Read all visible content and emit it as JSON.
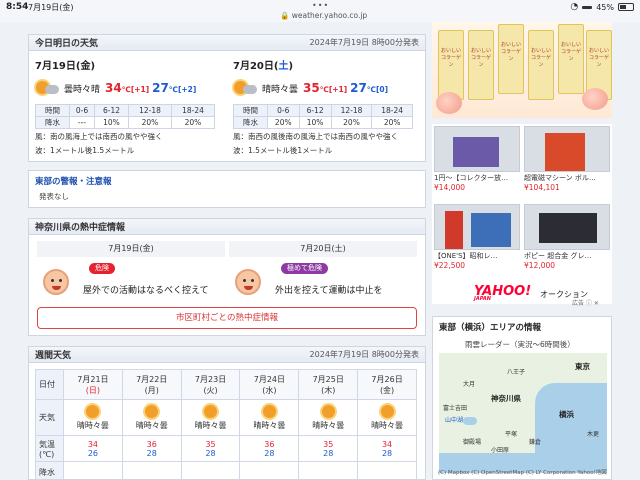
{
  "status_bar": {
    "time": "8:54",
    "date": "7月19日(金)",
    "dots": "•••",
    "url": "weather.yahoo.co.jp",
    "battery": "45%"
  },
  "forecast": {
    "title": "今日明日の天気",
    "published": "2024年7月19日 8時00分発表",
    "today": {
      "date_main": "7月19日(金)",
      "weather": "曇時々晴",
      "high": "34",
      "high_diff": "[+1]",
      "low": "27",
      "low_diff": "[+2]",
      "unit": "℃"
    },
    "tomorrow": {
      "date_prefix": "7月20日(",
      "date_day": "土",
      "date_suffix": ")",
      "weather": "晴時々曇",
      "high": "35",
      "high_diff": "[+1]",
      "low": "27",
      "low_diff": "[0]",
      "unit": "℃"
    },
    "table_labels": {
      "time": "時間",
      "rain": "降水"
    },
    "periods": [
      "0-6",
      "6-12",
      "12-18",
      "18-24"
    ],
    "today_rain": [
      "---",
      "10%",
      "20%",
      "20%"
    ],
    "tomorrow_rain": [
      "20%",
      "10%",
      "20%",
      "20%"
    ],
    "today_wind": "風：南の風海上では南西の風やや強く",
    "today_wave": "波：1メートル後1.5メートル",
    "tomorrow_wind": "風：南西の風後南の風海上では南西の風やや強く",
    "tomorrow_wave": "波：1.5メートル後1メートル"
  },
  "warnings": {
    "title": "東部の警報・注意報",
    "body": "発表なし"
  },
  "heatstroke": {
    "title": "神奈川県の熱中症情報",
    "tabs": [
      "7月19日(金)",
      "7月20日(土)"
    ],
    "items": [
      {
        "badge": "危険",
        "text": "屋外での活動はなるべく控えて",
        "color": "#e4232f"
      },
      {
        "badge": "極めて危険",
        "text": "外出を控えて運動は中止を",
        "color": "#8e3aa3"
      }
    ],
    "button": "市区町村ごとの熱中症情報"
  },
  "weekly": {
    "title": "週間天気",
    "published": "2024年7月19日 8時00分発表",
    "labels": {
      "date": "日付",
      "weather": "天気",
      "temp": "気温\n(℃)",
      "rain": "降水"
    },
    "days": [
      {
        "date": "7月21日",
        "dow": "(日)",
        "dow_color": "#e4232f",
        "weather": "晴時々曇",
        "high": "34",
        "low": "26"
      },
      {
        "date": "7月22日",
        "dow": "(月)",
        "dow_color": "#333333",
        "weather": "晴時々曇",
        "high": "36",
        "low": "28"
      },
      {
        "date": "7月23日",
        "dow": "(火)",
        "dow_color": "#333333",
        "weather": "晴時々曇",
        "high": "35",
        "low": "28"
      },
      {
        "date": "7月24日",
        "dow": "(水)",
        "dow_color": "#333333",
        "weather": "晴時々曇",
        "high": "36",
        "low": "28"
      },
      {
        "date": "7月25日",
        "dow": "(木)",
        "dow_color": "#333333",
        "weather": "晴時々曇",
        "high": "35",
        "low": "28"
      },
      {
        "date": "7月26日",
        "dow": "(金)",
        "dow_color": "#333333",
        "weather": "晴時々曇",
        "high": "34",
        "low": "28"
      }
    ]
  },
  "ads": {
    "drink_label": "おいしいコラーゲン",
    "shop_items": [
      {
        "name": "1円〜【コレクター放…",
        "price": "¥14,000"
      },
      {
        "name": "超電磁マシーン ボル…",
        "price": "¥104,101"
      },
      {
        "name": "【ONE'S】昭和レ…",
        "price": "¥22,500"
      },
      {
        "name": "ポピー 超合金 グレ…",
        "price": "¥12,000"
      }
    ],
    "yahoo_logo": "YAHOO!",
    "yahoo_japan": "JAPAN",
    "auction": "オークション",
    "ad_mark": "広告"
  },
  "area": {
    "title": "東部（横浜）エリアの情報",
    "radar": "雨雲レーダー（実況〜6時間後）",
    "places": [
      "八王子",
      "東京",
      "大月",
      "神奈川県",
      "富士吉田",
      "横浜",
      "山中湖",
      "御殿場",
      "平塚",
      "小田原",
      "鎌倉",
      "木更"
    ],
    "credit": "(C) Mapbox (C) OpenStreetMap (C) LY Corporation Yahoo!地図"
  }
}
